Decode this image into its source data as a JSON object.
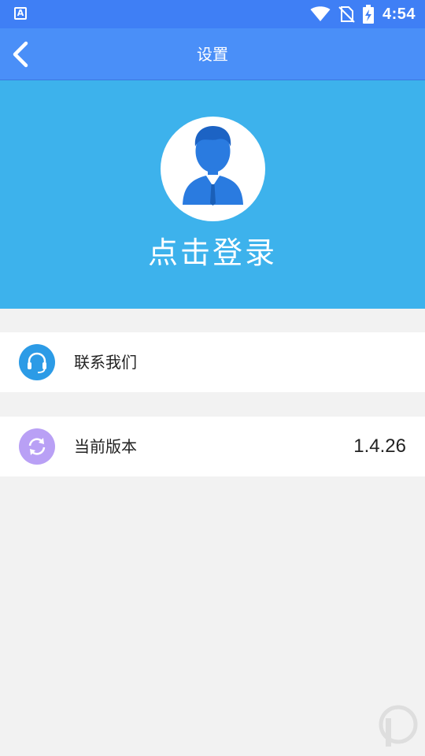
{
  "status_bar": {
    "app_badge": "A",
    "time": "4:54"
  },
  "nav": {
    "title": "设置"
  },
  "profile": {
    "login_label": "点击登录"
  },
  "settings": {
    "contact_label": "联系我们",
    "version_label": "当前版本",
    "version_value": "1.4.26"
  },
  "colors": {
    "status_bar": "#3f7ff5",
    "nav_bar": "#4a8ff8",
    "banner": "#3db2ec",
    "contact_icon_bg": "#2c9be6",
    "version_icon_bg": "#b9a0f5"
  },
  "icons": {
    "back": "chevron-left-icon",
    "avatar": "user-icon",
    "contact": "headset-icon",
    "version": "refresh-icon"
  }
}
